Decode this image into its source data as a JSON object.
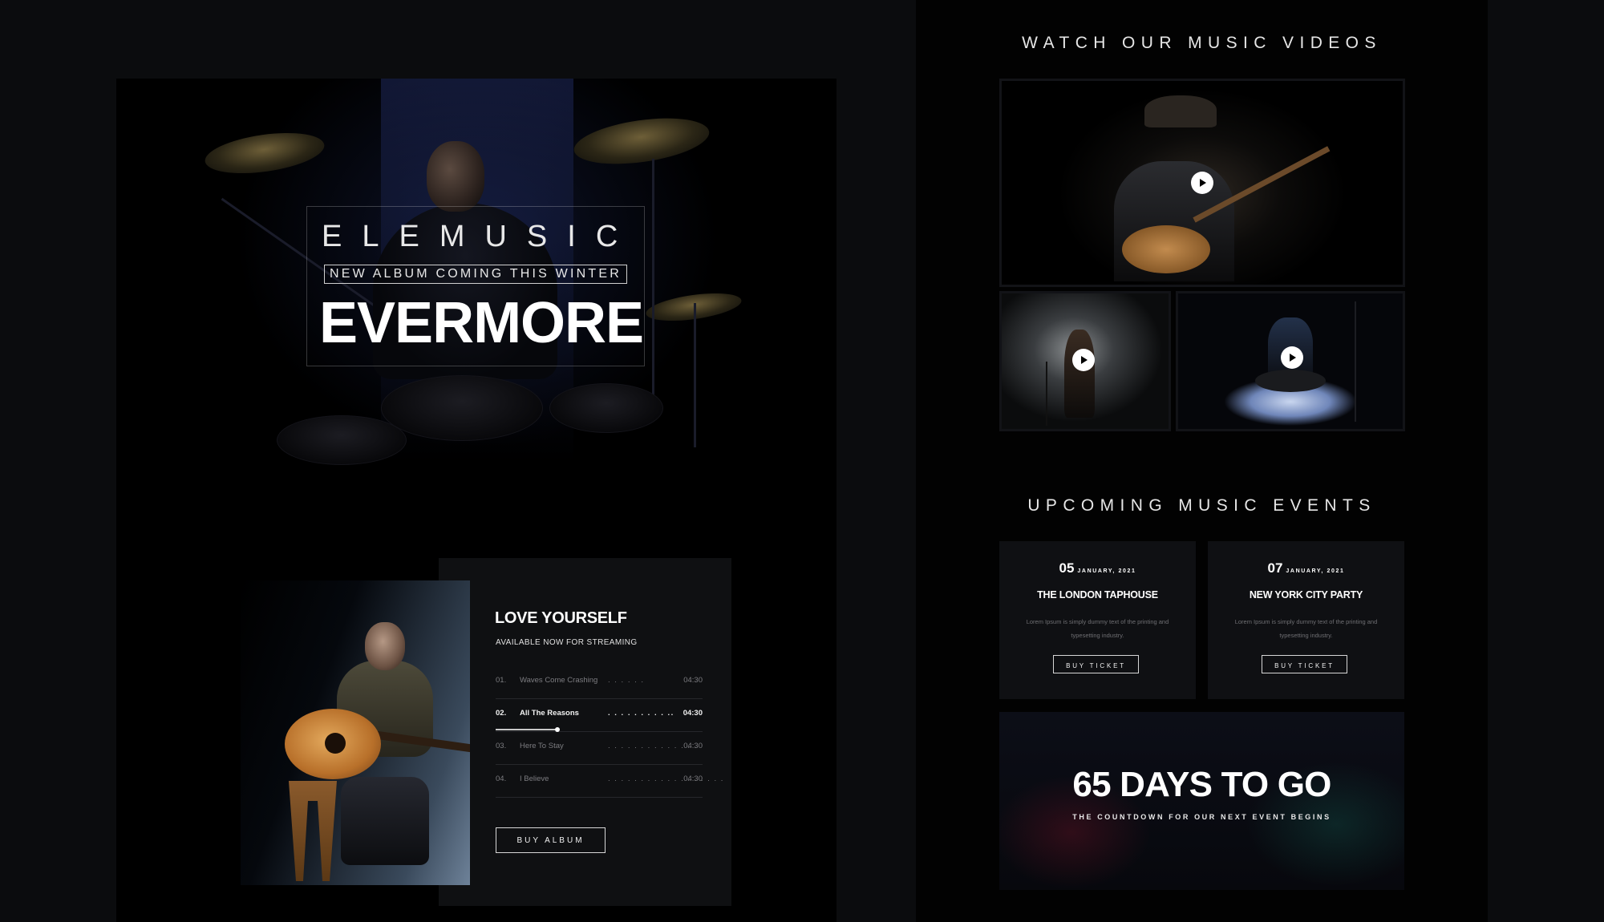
{
  "hero": {
    "brand": "ELEMUSIC",
    "tagline": "NEW ALBUM COMING THIS WINTER",
    "album_title": "EVERMORE"
  },
  "album": {
    "title": "LOVE YOURSELF",
    "subtitle": "AVAILABLE NOW FOR STREAMING",
    "tracks": [
      {
        "num": "01.",
        "name": "Waves Come Crashing",
        "dots": ". . . . . .",
        "time": "04:30"
      },
      {
        "num": "02.",
        "name": "All The Reasons",
        "dots": ". . . . . . . . . ..",
        "time": "04:30"
      },
      {
        "num": "03.",
        "name": "Here To Stay",
        "dots": ". . . . . . . . . . . . . .",
        "time": "04:30"
      },
      {
        "num": "04.",
        "name": "I Believe",
        "dots": ". . . . . . . . . . . . . . . . . .",
        "time": "04:30"
      }
    ],
    "active_track": "02.",
    "progress": 0.3,
    "buy_label": "BUY ALBUM"
  },
  "videos": {
    "title": "WATCH OUR MUSIC VIDEOS"
  },
  "events": {
    "title": "UPCOMING MUSIC EVENTS",
    "items": [
      {
        "day": "05",
        "month_year": "JANUARY, 2021",
        "name": "THE LONDON TAPHOUSE",
        "desc": "Lorem Ipsum is simply dummy text of the printing and typesetting industry.",
        "button": "BUY TICKET"
      },
      {
        "day": "07",
        "month_year": "JANUARY, 2021",
        "name": "NEW YORK CITY PARTY",
        "desc": "Lorem Ipsum is simply dummy text of the printing and typesetting industry.",
        "button": "BUY TICKET"
      }
    ]
  },
  "countdown": {
    "headline": "65 DAYS TO GO",
    "sub": "THE COUNTDOWN FOR OUR NEXT EVENT BEGINS"
  },
  "colors": {
    "page_bg": "#0b0c0e",
    "panel_bg": "#000000",
    "card_bg": "#0f1012",
    "text": "#ffffff",
    "muted": "#7c7c80"
  }
}
